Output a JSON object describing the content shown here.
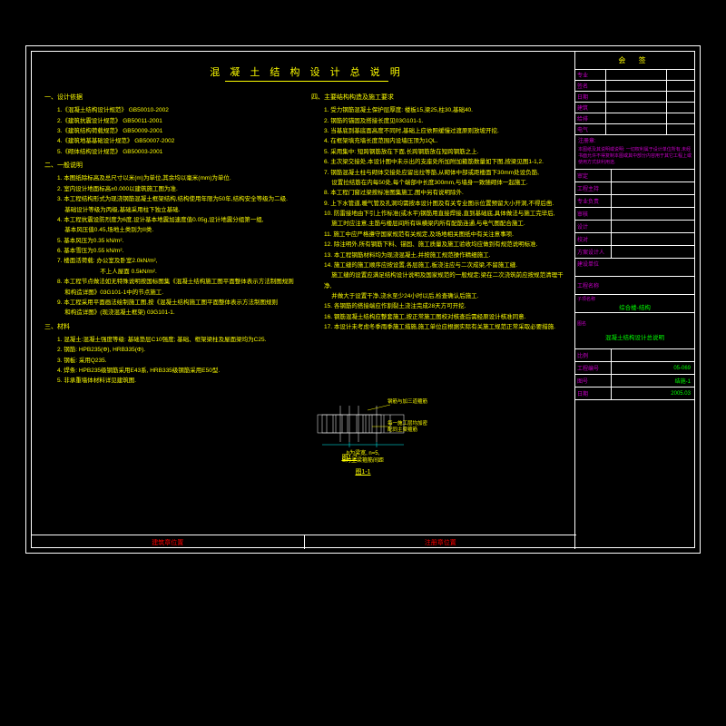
{
  "title": "混 凝 土 结 构 设 计 总 说 明",
  "left": {
    "sec1": "一、设计依据",
    "s1_items": [
      "1.《混凝土结构设计规范》 GB50010-2002",
      "2.《建筑抗震设计规范》 GB50011-2001",
      "3.《建筑结构荷载规范》 GB50009-2001",
      "4.《建筑地基基础设计规范》 GB50007-2002",
      "5.《砌体结构设计规范》 GB50003-2001"
    ],
    "sec2": "二、一般说明",
    "s2_items": [
      "1. 本图纸除标高及总尺寸以米(m)为单位,其余均以毫米(mm)为单位.",
      "2. 室内设计地面标高±0.000以建筑施工图为准.",
      "3. 本工程结构形式为现浇钢筋混凝土框架结构,结构使用年限为50年,结构安全等级为二级.",
      "　 基础设计等级为丙级,基础采用柱下独立基础.",
      "4. 本工程抗震设防烈度为6度,设计基本地震加速度值0.05g,设计地震分组第一组,",
      "　 基本风压值0.45,场地土类别为II类.",
      "5. 基本风压为0.35 kN/m².",
      "6. 基本雪压为0.55 kN/m².",
      "7. 楼面活荷载: 办公室及卧室2.0kN/m²,",
      "　　　　　　　 不上人屋面 0.5kN/m².",
      "8. 本工程节点做法如无特殊说明按国标图集《混凝土结构施工图平面整体表示方法制图规则",
      "　 和构造详图》03G101-1中的节点施工.",
      "9. 本工程采用平面画法绘制施工图,按《混凝土结构施工图平面整体表示方法制图规则",
      "　 和构造详图》(现浇混凝土框架) 03G101-1."
    ],
    "sec3": "三、材料",
    "s3_items": [
      "1. 混凝土:混凝土强度等级: 基础垫层C10强度; 基础、框架梁柱及屋面梁均为C25.",
      "2. 钢筋: HPB235(Φ), HRB335(Φ).",
      "3. 钢板: 采用Q235.",
      "4. 焊条: HPB235级钢筋采用E43系, HRB335级钢筋采用E50型.",
      "5. 非承重墙体材料详见建筑图."
    ]
  },
  "right": {
    "sec4": "四、主要结构构造及施工要求",
    "s4_items": [
      "1. 受力钢筋混凝土保护层厚度: 楼板15,梁25,柱30,基础40.",
      "2. 钢筋的锚固及搭接长度见03G101-1.",
      "3. 当基底到基底面高度不同时,基础上应依照缓慢过渡原则放坡开挖.",
      "4. 在框架填充墙长度范围内设墙压顶为1QL.",
      "5. 采用集中: 短跨钢筋放在下面,长跨钢筋放在短跨钢筋之上.",
      "6. 主次梁交接处,本设计图中未示出的支座处所加附加箍筋数量如下图,按梁见图1-1,2.",
      "7. 钢筋混凝土柱与砌体交接处应留出拉等筋,从砌体中部或距楼面下30mm处设负筋,",
      "　 设置拉结筋在内每50处,每个端部中长度300mm,与墙身一致随砌体一起施工.",
      "8. 本工程门窗过梁按标准图集施工,图中另有说明除外.",
      "9. 上下水管道,暖气管及孔洞均需按本设计图及有关专业图示位置预留大小开洞,不得后凿.",
      "10. 防雷接地由下引上作标准(或水平)钢筋用直接焊接,直到基础底,具体做法与施工完毕后,",
      "　  施工时应注意,主筋与楼层间所有纵横梁内所有配筋连通,与电气图配合施工.",
      "11. 施工中应严格遵守国家规范有关规定,及场地相关图纸中有关注意事项.",
      "12. 除注明外,所有钢筋下料、锚固、施工质量及施工验收均应做到有规范说明标准.",
      "13. 本工程钢筋材料均为现浇混凝土,并按施工规范操作精细施工.",
      "14. 施工缝的施工顺序应按设置,各层施工,板浇注应与二次成梁,不留施工缝.",
      "　  施工缝的设置应满足结构设计说明及国家规范的一般规定;梁在二次浇筑前应按规范清理干净,",
      "　  并做大于设置干净,浇水至少24小时以后,检查确认后施工.",
      "15. 各钢筋的搭接端应作割裂土浇注完成28天方可开挖.",
      "16. 钢筋混凝土结构应整套施工,按正常施工图校对核查后需经原设计核准同意.",
      "17. 本设计未考虑冬季雨季施工措施,施工单位应根据实际有关施工规范正常采取必要措施."
    ]
  },
  "fig1": {
    "label": "图1-1",
    "note1": "b为梁宽, n=5,",
    "note2": "S为主梁箍筋间距"
  },
  "fig2": {
    "label": "图1-2",
    "leader1": "钢筋与加三道箍筋",
    "leader2": "每一施工层均加密",
    "leader3": "配同主梁箍筋"
  },
  "titleblock": {
    "company": "会 签",
    "rows": [
      {
        "l": "专业",
        "v": ""
      },
      {
        "l": "签名",
        "v": ""
      },
      {
        "l": "日期",
        "v": ""
      },
      {
        "l": "建筑",
        "v": ""
      },
      {
        "l": "给排",
        "v": ""
      },
      {
        "l": "电气",
        "v": ""
      }
    ],
    "stamp_label": "注册章:",
    "stamp_text": "本图纸及其说明或说明: 一切权利属于设计单位所有,未经书面允许不得复制本图或其中部分内容用于其它工程上或使用方式获利用途.",
    "rows2": [
      {
        "l": "审定",
        "v": ""
      },
      {
        "l": "工程主持",
        "v": ""
      },
      {
        "l": "专业负责",
        "v": ""
      },
      {
        "l": "审核",
        "v": ""
      },
      {
        "l": "设计",
        "v": ""
      },
      {
        "l": "校对",
        "v": ""
      },
      {
        "l": "方案设计人",
        "v": ""
      }
    ],
    "unit_label": "建设单位",
    "proj_label": "工程名称",
    "sub_label": "子项名称",
    "sub_val": "综合楼-结构",
    "drawing_label": "图名",
    "drawing_val": "混凝土结构设计总说明",
    "footer": [
      {
        "l": "比例",
        "v": ""
      },
      {
        "l": "工程编号",
        "v": "05-069"
      },
      {
        "l": "图号",
        "v": "结施-1"
      },
      {
        "l": "日期",
        "v": "2005.03"
      }
    ]
  },
  "seals": {
    "a": "建筑章位置",
    "b": "注册章位置"
  }
}
